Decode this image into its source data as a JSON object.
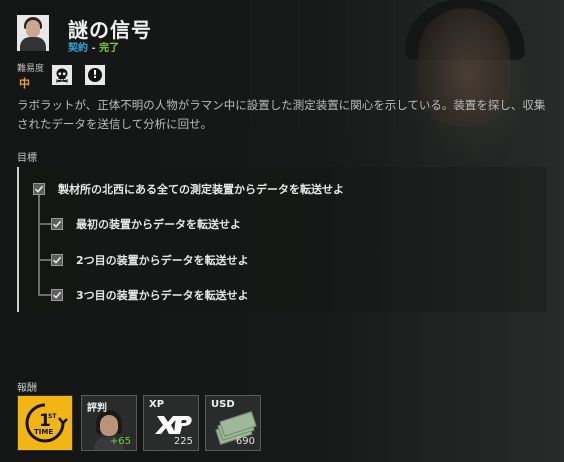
{
  "mission": {
    "title": "謎の信号",
    "type": "契約",
    "separator": " - ",
    "status": "完了",
    "difficulty_label": "難易度",
    "difficulty_value": "中",
    "difficulty_icons": [
      "skull-icon",
      "alert-icon"
    ],
    "description": "ラボラットが、正体不明の人物がラマン中に設置した測定装置に関心を示している。装置を探し、収集されたデータを送信して分析に回せ。"
  },
  "objectives": {
    "label": "目標",
    "items": [
      {
        "text": "製材所の北西にある全ての測定装置からデータを転送せよ",
        "checked": true,
        "level": 0
      },
      {
        "text": "最初の装置からデータを転送せよ",
        "checked": true,
        "level": 1
      },
      {
        "text": "2つ目の装置からデータを転送せよ",
        "checked": true,
        "level": 1
      },
      {
        "text": "3つ目の装置からデータを転送せよ",
        "checked": true,
        "level": 1
      }
    ]
  },
  "rewards": {
    "label": "報酬",
    "items": [
      {
        "kind": "first-time",
        "title": "",
        "value": ""
      },
      {
        "kind": "reputation",
        "title": "評判",
        "value": "+65"
      },
      {
        "kind": "xp",
        "title": "XP",
        "value": "225"
      },
      {
        "kind": "usd",
        "title": "USD",
        "value": "690"
      }
    ]
  },
  "colors": {
    "accent_blue": "#2aa8d8",
    "complete_green": "#7fd13b",
    "difficulty_orange": "#e8a030",
    "first_time_yellow": "#f2b514"
  }
}
